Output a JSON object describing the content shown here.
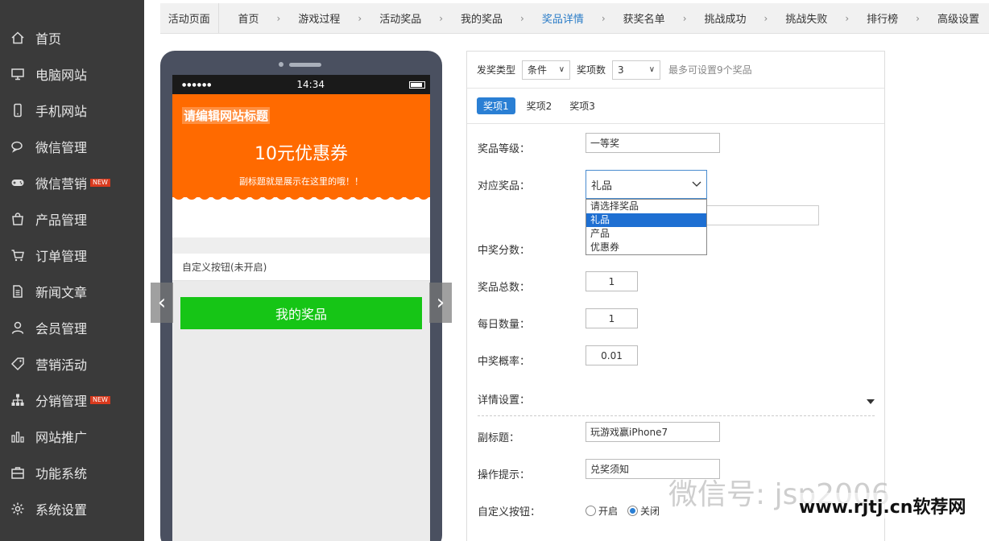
{
  "sidebar": {
    "items": [
      {
        "label": "首页",
        "icon": "home-icon"
      },
      {
        "label": "电脑网站",
        "icon": "monitor-icon"
      },
      {
        "label": "手机网站",
        "icon": "mobile-icon"
      },
      {
        "label": "微信管理",
        "icon": "chat-icon"
      },
      {
        "label": "微信营销",
        "icon": "gamepad-icon",
        "badge": "NEW"
      },
      {
        "label": "产品管理",
        "icon": "bag-icon"
      },
      {
        "label": "订单管理",
        "icon": "cart-icon"
      },
      {
        "label": "新闻文章",
        "icon": "document-icon"
      },
      {
        "label": "会员管理",
        "icon": "user-icon"
      },
      {
        "label": "营销活动",
        "icon": "tag-icon"
      },
      {
        "label": "分销管理",
        "icon": "sitemap-icon",
        "badge": "NEW"
      },
      {
        "label": "网站推广",
        "icon": "bar-chart-icon"
      },
      {
        "label": "功能系统",
        "icon": "briefcase-icon"
      },
      {
        "label": "系统设置",
        "icon": "gear-icon"
      }
    ]
  },
  "topnav": {
    "first": "活动页面",
    "items": [
      "首页",
      "游戏过程",
      "活动奖品",
      "我的奖品",
      "奖品详情",
      "获奖名单",
      "挑战成功",
      "挑战失败",
      "排行榜",
      "高级设置"
    ],
    "active_index": 4
  },
  "phone": {
    "status_signal": "●●●●●●",
    "status_time": "14:34",
    "site_title": "请编辑网站标题",
    "coupon": "10元优惠券",
    "subtitle": "副标题就是展示在这里的哦！！",
    "custom_button_label": "自定义按钮(未开启)",
    "my_prize_button": "我的奖品",
    "prev_arrow": "‹",
    "next_arrow": "›"
  },
  "panel": {
    "prize_type_label": "发奖类型",
    "prize_type_value": "条件",
    "prize_count_label": "奖项数",
    "prize_count_value": "3",
    "prize_count_hint": "最多可设置9个奖品",
    "tabs": [
      "奖项1",
      "奖项2",
      "奖项3"
    ],
    "active_tab": 0,
    "level_label": "奖品等级：",
    "level_value": "一等奖",
    "prize_label": "对应奖品：",
    "prize_value": "礼品",
    "dropdown_options": [
      "请选择奖品",
      "礼品",
      "产品",
      "优惠券"
    ],
    "dropdown_selected": 1,
    "score_label": "中奖分数：",
    "total_label": "奖品总数：",
    "total_value": "1",
    "daily_label": "每日数量：",
    "daily_value": "1",
    "prob_label": "中奖概率：",
    "prob_value": "0.01",
    "detail_label": "详情设置：",
    "subtitle_label": "副标题：",
    "subtitle_value": "玩游戏赢iPhone7",
    "tip_label": "操作提示：",
    "tip_value": "兑奖须知",
    "custom_btn_label": "自定义按钮：",
    "radio_on": "开启",
    "radio_off": "关闭"
  },
  "watermark": {
    "wechat": "微信号: jsp2006",
    "site": "www.rjtj.cn软荐网"
  },
  "colors": {
    "sidebar_bg": "#3a3a3a",
    "banner": "#ff6a00",
    "green_button": "#16c516",
    "accent_blue": "#2a7fd4"
  }
}
